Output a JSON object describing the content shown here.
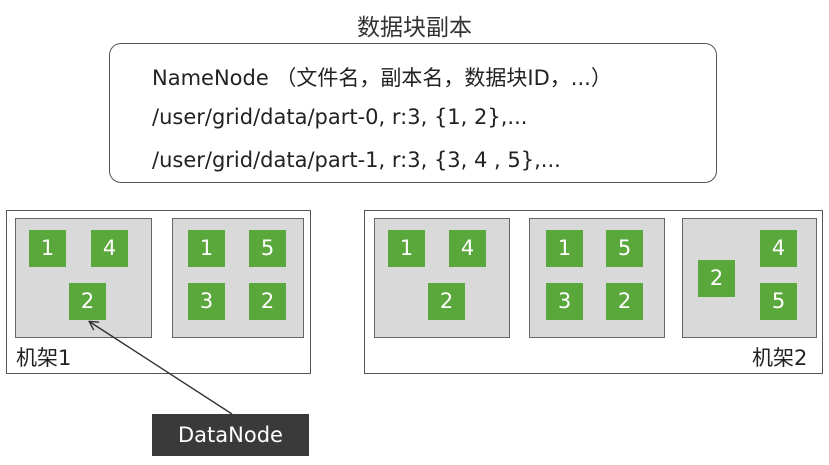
{
  "title": "数据块副本",
  "namenode": {
    "line1": "NameNode （文件名，副本名，数据块ID，...）",
    "line2": "/user/grid/data/part-0,  r:3,  {1,  2},...",
    "line3": "/user/grid/data/part-1,  r:3,  {3,  4 ,  5},..."
  },
  "racks": [
    {
      "label": "机架1",
      "nodes": [
        {
          "blocks": [
            "1",
            "4",
            "2"
          ]
        },
        {
          "blocks": [
            "1",
            "5",
            "3",
            "2"
          ]
        }
      ]
    },
    {
      "label": "机架2",
      "nodes": [
        {
          "blocks": [
            "1",
            "4",
            "2"
          ]
        },
        {
          "blocks": [
            "1",
            "5",
            "3",
            "2"
          ]
        },
        {
          "blocks": [
            "4",
            "2",
            "5"
          ]
        }
      ]
    }
  ],
  "datanode_label": "DataNode",
  "colors": {
    "block_fill": "#5aa83c",
    "node_fill": "#d9d9d9",
    "label_fill": "#3a3a3a"
  }
}
